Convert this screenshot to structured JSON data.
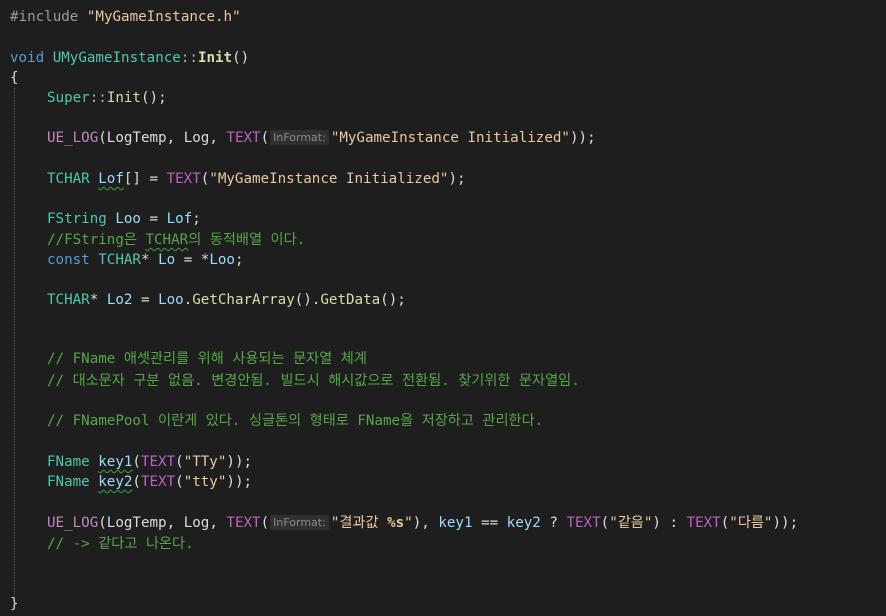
{
  "editor": {
    "lines": [
      {
        "indent": 0,
        "tokens": [
          {
            "t": "#include ",
            "c": "pre"
          },
          {
            "t": "\"MyGameInstance.h\"",
            "c": "str"
          }
        ]
      },
      {
        "indent": 0,
        "tokens": [
          {
            "t": "void ",
            "c": "kw"
          },
          {
            "t": "UMyGameInstance",
            "c": "type"
          },
          {
            "t": "::",
            "c": "punc"
          },
          {
            "t": "Init",
            "c": "fn",
            "b": true
          },
          {
            "t": "()",
            "c": "plain"
          }
        ]
      },
      {
        "indent": 0,
        "tokens": [
          {
            "t": "{",
            "c": "plain"
          }
        ]
      },
      {
        "indent": 1,
        "tokens": [
          {
            "t": "Super",
            "c": "type"
          },
          {
            "t": "::",
            "c": "punc"
          },
          {
            "t": "Init",
            "c": "fn"
          },
          {
            "t": "();",
            "c": "plain"
          }
        ]
      },
      {
        "indent": 1,
        "tokens": [
          {
            "t": "UE_LOG",
            "c": "mac"
          },
          {
            "t": "(",
            "c": "plain"
          },
          {
            "t": "LogTemp",
            "c": "plain"
          },
          {
            "t": ", ",
            "c": "plain"
          },
          {
            "t": "Log",
            "c": "plain"
          },
          {
            "t": ", ",
            "c": "plain"
          },
          {
            "t": "TEXT",
            "c": "macf"
          },
          {
            "t": "(",
            "c": "plain"
          },
          {
            "t": "InFormat:",
            "c": "hint"
          },
          {
            "t": "\"MyGameInstance Initialized\"",
            "c": "str"
          },
          {
            "t": "));",
            "c": "plain"
          }
        ]
      },
      {
        "indent": 1,
        "tokens": [
          {
            "t": "TCHAR ",
            "c": "type"
          },
          {
            "t": "Lof",
            "c": "var",
            "sq": true
          },
          {
            "t": "[] = ",
            "c": "plain"
          },
          {
            "t": "TEXT",
            "c": "macf"
          },
          {
            "t": "(",
            "c": "plain"
          },
          {
            "t": "\"MyGameInstance Initialized\"",
            "c": "str"
          },
          {
            "t": ");",
            "c": "plain"
          }
        ]
      },
      {
        "indent": 1,
        "tokens": [
          {
            "t": "FString ",
            "c": "type"
          },
          {
            "t": "Loo",
            "c": "var"
          },
          {
            "t": " = ",
            "c": "plain"
          },
          {
            "t": "Lof",
            "c": "var"
          },
          {
            "t": ";",
            "c": "plain"
          }
        ]
      },
      {
        "indent": 1,
        "tokens": [
          {
            "t": "//FString은 ",
            "c": "cmt"
          },
          {
            "t": "TCHAR",
            "c": "cmt",
            "sq": true
          },
          {
            "t": "의 동적배열 이다.",
            "c": "cmt"
          }
        ]
      },
      {
        "indent": 1,
        "tokens": [
          {
            "t": "const ",
            "c": "kw"
          },
          {
            "t": "TCHAR",
            "c": "type"
          },
          {
            "t": "* ",
            "c": "plain"
          },
          {
            "t": "Lo",
            "c": "var"
          },
          {
            "t": " = *",
            "c": "plain"
          },
          {
            "t": "Loo",
            "c": "var"
          },
          {
            "t": ";",
            "c": "plain"
          }
        ]
      },
      {
        "indent": 1,
        "tokens": [
          {
            "t": "TCHAR",
            "c": "type"
          },
          {
            "t": "* ",
            "c": "plain"
          },
          {
            "t": "Lo2",
            "c": "var"
          },
          {
            "t": " = ",
            "c": "plain"
          },
          {
            "t": "Loo",
            "c": "var"
          },
          {
            "t": ".",
            "c": "plain"
          },
          {
            "t": "GetCharArray",
            "c": "fn"
          },
          {
            "t": "().",
            "c": "plain"
          },
          {
            "t": "GetData",
            "c": "fn"
          },
          {
            "t": "();",
            "c": "plain"
          }
        ]
      },
      {
        "indent": 1,
        "tokens": [
          {
            "t": "// FName 애셋관리를 위해 사용되는 문자열 체계",
            "c": "cmt"
          }
        ]
      },
      {
        "indent": 1,
        "tokens": [
          {
            "t": "// 대소문자 구분 없음. 변경안됨. 빌드시 해시값으로 전환됨. 찾기위한 문자열임.",
            "c": "cmt"
          }
        ]
      },
      {
        "indent": 1,
        "tokens": [
          {
            "t": "// FNamePool 이란게 있다. 싱글톤의 형태로 FName을 저장하고 관리한다.",
            "c": "cmt"
          }
        ]
      },
      {
        "indent": 1,
        "tokens": [
          {
            "t": "FName ",
            "c": "type"
          },
          {
            "t": "key1",
            "c": "var",
            "sq": true
          },
          {
            "t": "(",
            "c": "plain"
          },
          {
            "t": "TEXT",
            "c": "macf"
          },
          {
            "t": "(",
            "c": "plain"
          },
          {
            "t": "\"TTy\"",
            "c": "str"
          },
          {
            "t": "));",
            "c": "plain"
          }
        ]
      },
      {
        "indent": 1,
        "tokens": [
          {
            "t": "FName ",
            "c": "type"
          },
          {
            "t": "key2",
            "c": "var",
            "sq": true
          },
          {
            "t": "(",
            "c": "plain"
          },
          {
            "t": "TEXT",
            "c": "macf"
          },
          {
            "t": "(",
            "c": "plain"
          },
          {
            "t": "\"tty\"",
            "c": "str"
          },
          {
            "t": "));",
            "c": "plain"
          }
        ]
      },
      {
        "indent": 1,
        "tokens": [
          {
            "t": "UE_LOG",
            "c": "mac"
          },
          {
            "t": "(",
            "c": "plain"
          },
          {
            "t": "LogTemp",
            "c": "plain"
          },
          {
            "t": ", ",
            "c": "plain"
          },
          {
            "t": "Log",
            "c": "plain"
          },
          {
            "t": ", ",
            "c": "plain"
          },
          {
            "t": "TEXT",
            "c": "macf"
          },
          {
            "t": "(",
            "c": "plain"
          },
          {
            "t": "InFormat:",
            "c": "hint"
          },
          {
            "t": "\"결과값 ",
            "c": "str"
          },
          {
            "t": "%s",
            "c": "fmt"
          },
          {
            "t": "\"",
            "c": "str"
          },
          {
            "t": "), ",
            "c": "plain"
          },
          {
            "t": "key1",
            "c": "var"
          },
          {
            "t": " == ",
            "c": "plain"
          },
          {
            "t": "key2",
            "c": "var"
          },
          {
            "t": " ? ",
            "c": "plain"
          },
          {
            "t": "TEXT",
            "c": "macf"
          },
          {
            "t": "(",
            "c": "plain"
          },
          {
            "t": "\"같음\"",
            "c": "str"
          },
          {
            "t": ") : ",
            "c": "plain"
          },
          {
            "t": "TEXT",
            "c": "macf"
          },
          {
            "t": "(",
            "c": "plain"
          },
          {
            "t": "\"다름\"",
            "c": "str"
          },
          {
            "t": "));",
            "c": "plain"
          }
        ]
      },
      {
        "indent": 1,
        "tokens": [
          {
            "t": "// -> 같다고 나온다.",
            "c": "cmt"
          }
        ]
      },
      {
        "indent": 0,
        "tokens": [
          {
            "t": "}",
            "c": "plain"
          }
        ]
      }
    ]
  }
}
